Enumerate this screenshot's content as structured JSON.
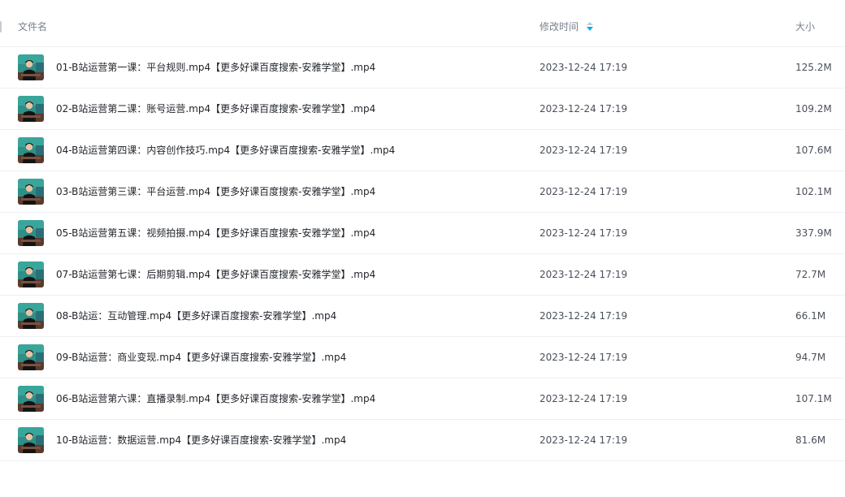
{
  "header": {
    "name_label": "文件名",
    "time_label": "修改时间",
    "size_label": "大小",
    "sort_icon": "sort-desc-icon"
  },
  "files": [
    {
      "name": "01-B站运营第一课：平台规则.mp4【更多好课百度搜索-安雅学堂】.mp4",
      "modified": "2023-12-24 17:19",
      "size": "125.2M",
      "thumb": "video-thumbnail"
    },
    {
      "name": "02-B站运营第二课：账号运营.mp4【更多好课百度搜索-安雅学堂】.mp4",
      "modified": "2023-12-24 17:19",
      "size": "109.2M",
      "thumb": "video-thumbnail"
    },
    {
      "name": "04-B站运营第四课：内容创作技巧.mp4【更多好课百度搜索-安雅学堂】.mp4",
      "modified": "2023-12-24 17:19",
      "size": "107.6M",
      "thumb": "video-thumbnail"
    },
    {
      "name": "03-B站运营第三课：平台运营.mp4【更多好课百度搜索-安雅学堂】.mp4",
      "modified": "2023-12-24 17:19",
      "size": "102.1M",
      "thumb": "video-thumbnail"
    },
    {
      "name": "05-B站运营第五课：视频拍摄.mp4【更多好课百度搜索-安雅学堂】.mp4",
      "modified": "2023-12-24 17:19",
      "size": "337.9M",
      "thumb": "video-thumbnail"
    },
    {
      "name": "07-B站运营第七课：后期剪辑.mp4【更多好课百度搜索-安雅学堂】.mp4",
      "modified": "2023-12-24 17:19",
      "size": "72.7M",
      "thumb": "video-thumbnail"
    },
    {
      "name": "08-B站运：互动管理.mp4【更多好课百度搜索-安雅学堂】.mp4",
      "modified": "2023-12-24 17:19",
      "size": "66.1M",
      "thumb": "video-thumbnail"
    },
    {
      "name": "09-B站运营：商业变现.mp4【更多好课百度搜索-安雅学堂】.mp4",
      "modified": "2023-12-24 17:19",
      "size": "94.7M",
      "thumb": "video-thumbnail"
    },
    {
      "name": "06-B站运营第六课：直播录制.mp4【更多好课百度搜索-安雅学堂】.mp4",
      "modified": "2023-12-24 17:19",
      "size": "107.1M",
      "thumb": "video-thumbnail"
    },
    {
      "name": "10-B站运营：数据运营.mp4【更多好课百度搜索-安雅学堂】.mp4",
      "modified": "2023-12-24 17:19",
      "size": "81.6M",
      "thumb": "video-thumbnail"
    }
  ],
  "colors": {
    "text_primary": "#1f2329",
    "text_secondary": "#4a505a",
    "header_text": "#7a818c",
    "divider": "#eef0f3",
    "sort_active": "#06a7ff"
  }
}
